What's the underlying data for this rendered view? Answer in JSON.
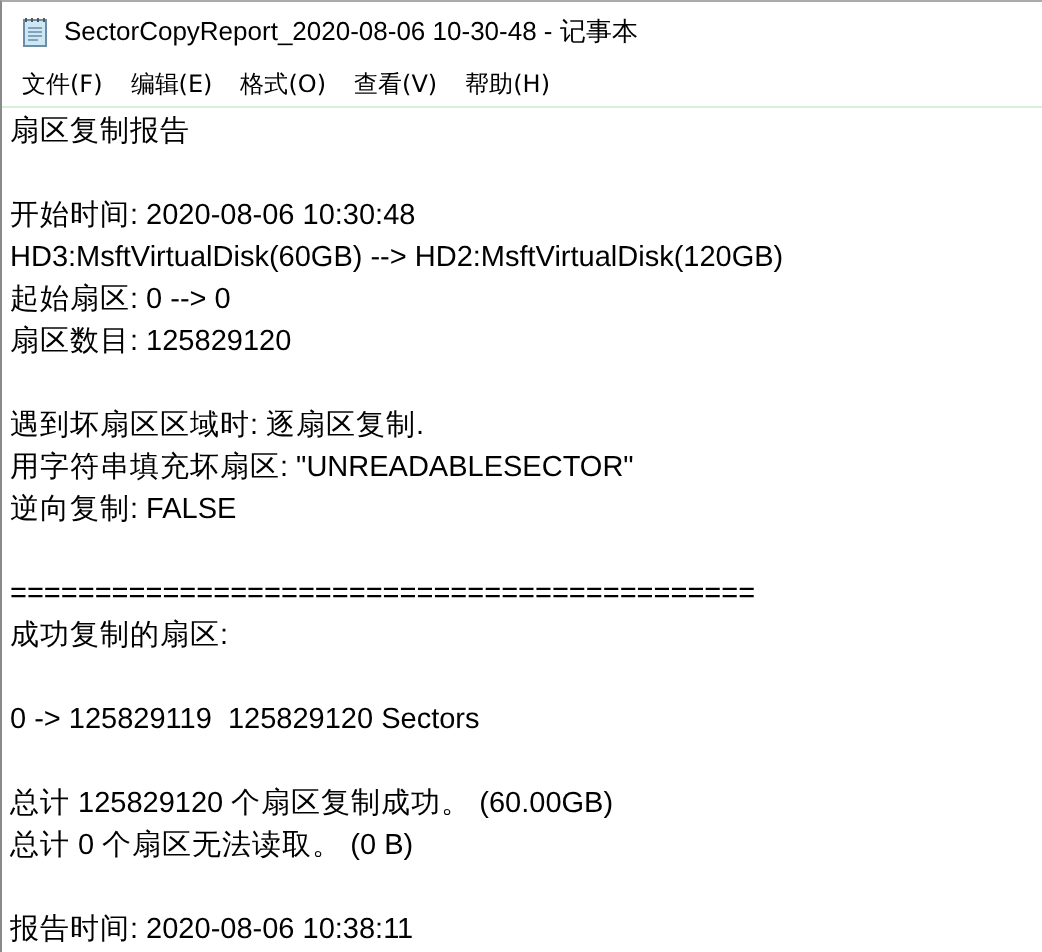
{
  "window": {
    "title": "SectorCopyReport_2020-08-06 10-30-48 - 记事本"
  },
  "menu": [
    "文件(F)",
    "编辑(E)",
    "格式(O)",
    "查看(V)",
    "帮助(H)"
  ],
  "lines": [
    {
      "kind": "text",
      "text": "扇区复制报告"
    },
    {
      "kind": "blank"
    },
    {
      "kind": "text",
      "text": "开始时间: 2020-08-06 10:30:48"
    },
    {
      "kind": "text",
      "text": "HD3:MsftVirtualDisk(60GB) --> HD2:MsftVirtualDisk(120GB)"
    },
    {
      "kind": "text",
      "text": "起始扇区: 0 --> 0"
    },
    {
      "kind": "text",
      "text": "扇区数目: 125829120"
    },
    {
      "kind": "blank"
    },
    {
      "kind": "text",
      "text": "遇到坏扇区区域时: 逐扇区复制."
    },
    {
      "kind": "text",
      "text": "用字符串填充坏扇区: \"UNREADABLESECTOR\""
    },
    {
      "kind": "text",
      "text": "逆向复制: FALSE"
    },
    {
      "kind": "blank"
    },
    {
      "kind": "text",
      "text": "============================================"
    },
    {
      "kind": "text",
      "text": "成功复制的扇区:"
    },
    {
      "kind": "blank"
    },
    {
      "kind": "text",
      "text": "0 -> 125829119  125829120 Sectors"
    },
    {
      "kind": "blank"
    },
    {
      "kind": "text",
      "text": "总计 125829120 个扇区复制成功。 (60.00GB)"
    },
    {
      "kind": "text",
      "text": "总计 0 个扇区无法读取。 (0 B)"
    },
    {
      "kind": "blank"
    },
    {
      "kind": "text",
      "text": "报告时间: 2020-08-06 10:38:11"
    }
  ]
}
